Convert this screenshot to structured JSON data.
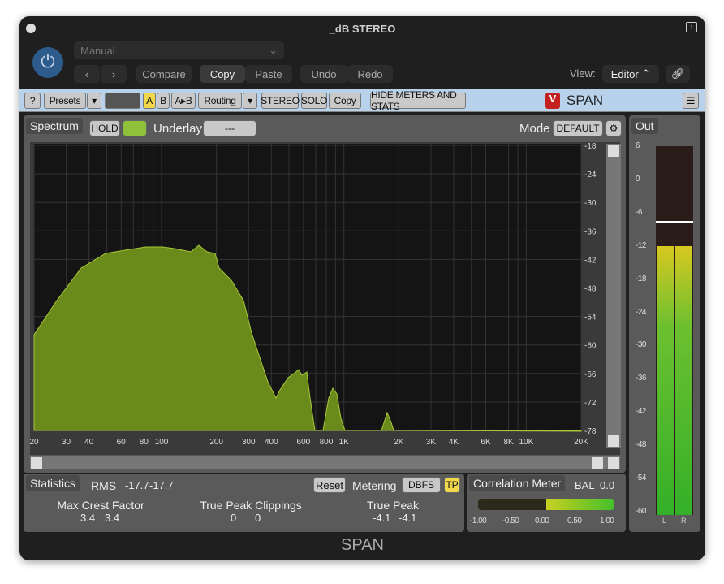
{
  "window": {
    "title": "_dB STEREO",
    "footer": "SPAN"
  },
  "host": {
    "preset": "Manual",
    "prev": "‹",
    "next": "›",
    "compare": "Compare",
    "copy": "Copy",
    "paste": "Paste",
    "undo": "Undo",
    "redo": "Redo",
    "view_label": "View:",
    "view_value": "Editor"
  },
  "toolbar": {
    "help": "?",
    "presets": "Presets",
    "a": "A",
    "b": "B",
    "ab": "A▸B",
    "routing": "Routing",
    "stereo": "STEREO",
    "solo": "SOLO",
    "copy": "Copy",
    "hide": "HIDE METERS AND STATS",
    "brand": "SPAN",
    "accent": "#f0d84a"
  },
  "spectrum": {
    "tab": "Spectrum",
    "hold": "HOLD",
    "underlay_label": "Underlay",
    "underlay_value": "---",
    "mode_label": "Mode",
    "mode_value": "DEFAULT",
    "db_ticks": [
      "-18",
      "-24",
      "-30",
      "-36",
      "-42",
      "-48",
      "-54",
      "-60",
      "-66",
      "-72",
      "-78"
    ],
    "freq_ticks": [
      [
        "20",
        20
      ],
      [
        "30",
        30
      ],
      [
        "40",
        40
      ],
      [
        "60",
        60
      ],
      [
        "80",
        80
      ],
      [
        "100",
        100
      ],
      [
        "200",
        200
      ],
      [
        "300",
        300
      ],
      [
        "400",
        400
      ],
      [
        "600",
        600
      ],
      [
        "800",
        800
      ],
      [
        "1K",
        1000
      ],
      [
        "2K",
        2000
      ],
      [
        "3K",
        3000
      ],
      [
        "4K",
        4000
      ],
      [
        "6K",
        6000
      ],
      [
        "8K",
        8000
      ],
      [
        "10K",
        10000
      ],
      [
        "20K",
        20000
      ]
    ],
    "fill_color": "#6b8a1c"
  },
  "stats": {
    "tab": "Statistics",
    "rms_label": "RMS",
    "rms_l": "-17.7",
    "rms_r": "-17.7",
    "reset": "Reset",
    "metering_label": "Metering",
    "metering_value": "DBFS",
    "tp": "TP",
    "crest_label": "Max Crest Factor",
    "crest_l": "3.4",
    "crest_r": "3.4",
    "clip_label": "True Peak Clippings",
    "clip_l": "0",
    "clip_r": "0",
    "tpk_label": "True Peak",
    "tpk_l": "-4.1",
    "tpk_r": "-4.1"
  },
  "correlation": {
    "tab": "Correlation Meter",
    "bal_label": "BAL",
    "bal_value": "0.0",
    "ticks": [
      "-1.00",
      "-0.50",
      "0.00",
      "0.50",
      "1.00"
    ]
  },
  "out": {
    "tab": "Out",
    "ticks": [
      "6",
      "0",
      "-6",
      "-12",
      "-18",
      "-24",
      "-30",
      "-36",
      "-42",
      "-48",
      "-54",
      "-60"
    ],
    "l": "L",
    "r": "R",
    "level_db": -12,
    "peak_db": -7.5
  }
}
